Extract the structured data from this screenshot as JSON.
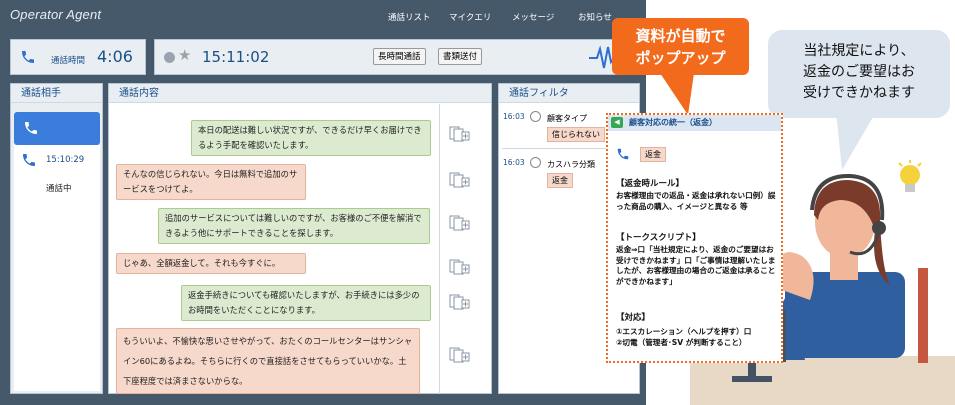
{
  "app": {
    "logo": "Operator Agent"
  },
  "nav": {
    "items": [
      "通話リスト",
      "マイクエリ",
      "メッセージ",
      "お知らせ"
    ]
  },
  "status": {
    "label": "通話時間",
    "duration": "4:06",
    "clock": "15:11:02",
    "btn_long": "長時間通話",
    "btn_doc": "書類送付"
  },
  "party": {
    "title": "通話相手",
    "time": "15:10:29",
    "state": "通話中"
  },
  "conversation": {
    "title": "通話内容",
    "messages": [
      {
        "side": "right",
        "tone": "green",
        "text": "本日の配送は難しい状況ですが、できるだけ早くお届けできるよう手配を確認いたします。"
      },
      {
        "side": "left",
        "tone": "orange",
        "text": "そんなの信じられない。今日は無料で追加のサービスをつけてよ。"
      },
      {
        "side": "right",
        "tone": "green",
        "text": "追加のサービスについては難しいのですが、お客様のご不便を解消できるよう他にサポートできることを探します。"
      },
      {
        "side": "left",
        "tone": "orange",
        "text": "じゃあ、全額返金して。それも今すぐに。"
      },
      {
        "side": "right",
        "tone": "green",
        "text": "返金手続きについても確認いたしますが、お手続きには多少のお時間をいただくことになります。"
      },
      {
        "side": "left",
        "tone": "orange",
        "text": "もういいよ、不愉快な思いさせやがって、おたくのコールセンターはサンシャイン60にあるよね。そちらに行くので直接話をさせてもらっていいかな。土下座程度では済まさないからな。"
      }
    ]
  },
  "filter": {
    "title": "通話フィルタ",
    "items": [
      {
        "time": "16:03",
        "label": "顧客タイプ",
        "tag": "信じられない"
      },
      {
        "time": "16:03",
        "label": "カスハラ分類",
        "tag": "返金"
      }
    ]
  },
  "callout": {
    "line1": "資料が自動で",
    "line2": "ポップアップ"
  },
  "speech": {
    "line1": "当社規定により、",
    "line2": "返金のご要望はお",
    "line3": "受けできかねます"
  },
  "popup": {
    "title": "顧客対応の統一（返金）",
    "tag": "返金",
    "rule_heading": "【返金時ルール】",
    "rule_text": "お客様理由での返品・返金は承れない口例）誤った商品の購入、イメージと異なる 等",
    "script_heading": "【トークスクリプト】",
    "script_text": "返金⇒口「当社規定により、返金のご要望はお受けできかねます」口「ご事情は理解いたしましたが、お客様理由の場合のご返金は承ることができかねます」",
    "action_heading": "【対応】",
    "action_1": "①エスカレーション（ヘルプを押す）口",
    "action_2": "②切電（管理者･SV が判断すること）"
  },
  "colors": {
    "frame": "#46596b",
    "panel": "#e9eef3",
    "accent": "#2f6fce",
    "callout": "#f26b1d",
    "green_bubble": "#dcebd0",
    "orange_bubble": "#f6d9cb"
  }
}
